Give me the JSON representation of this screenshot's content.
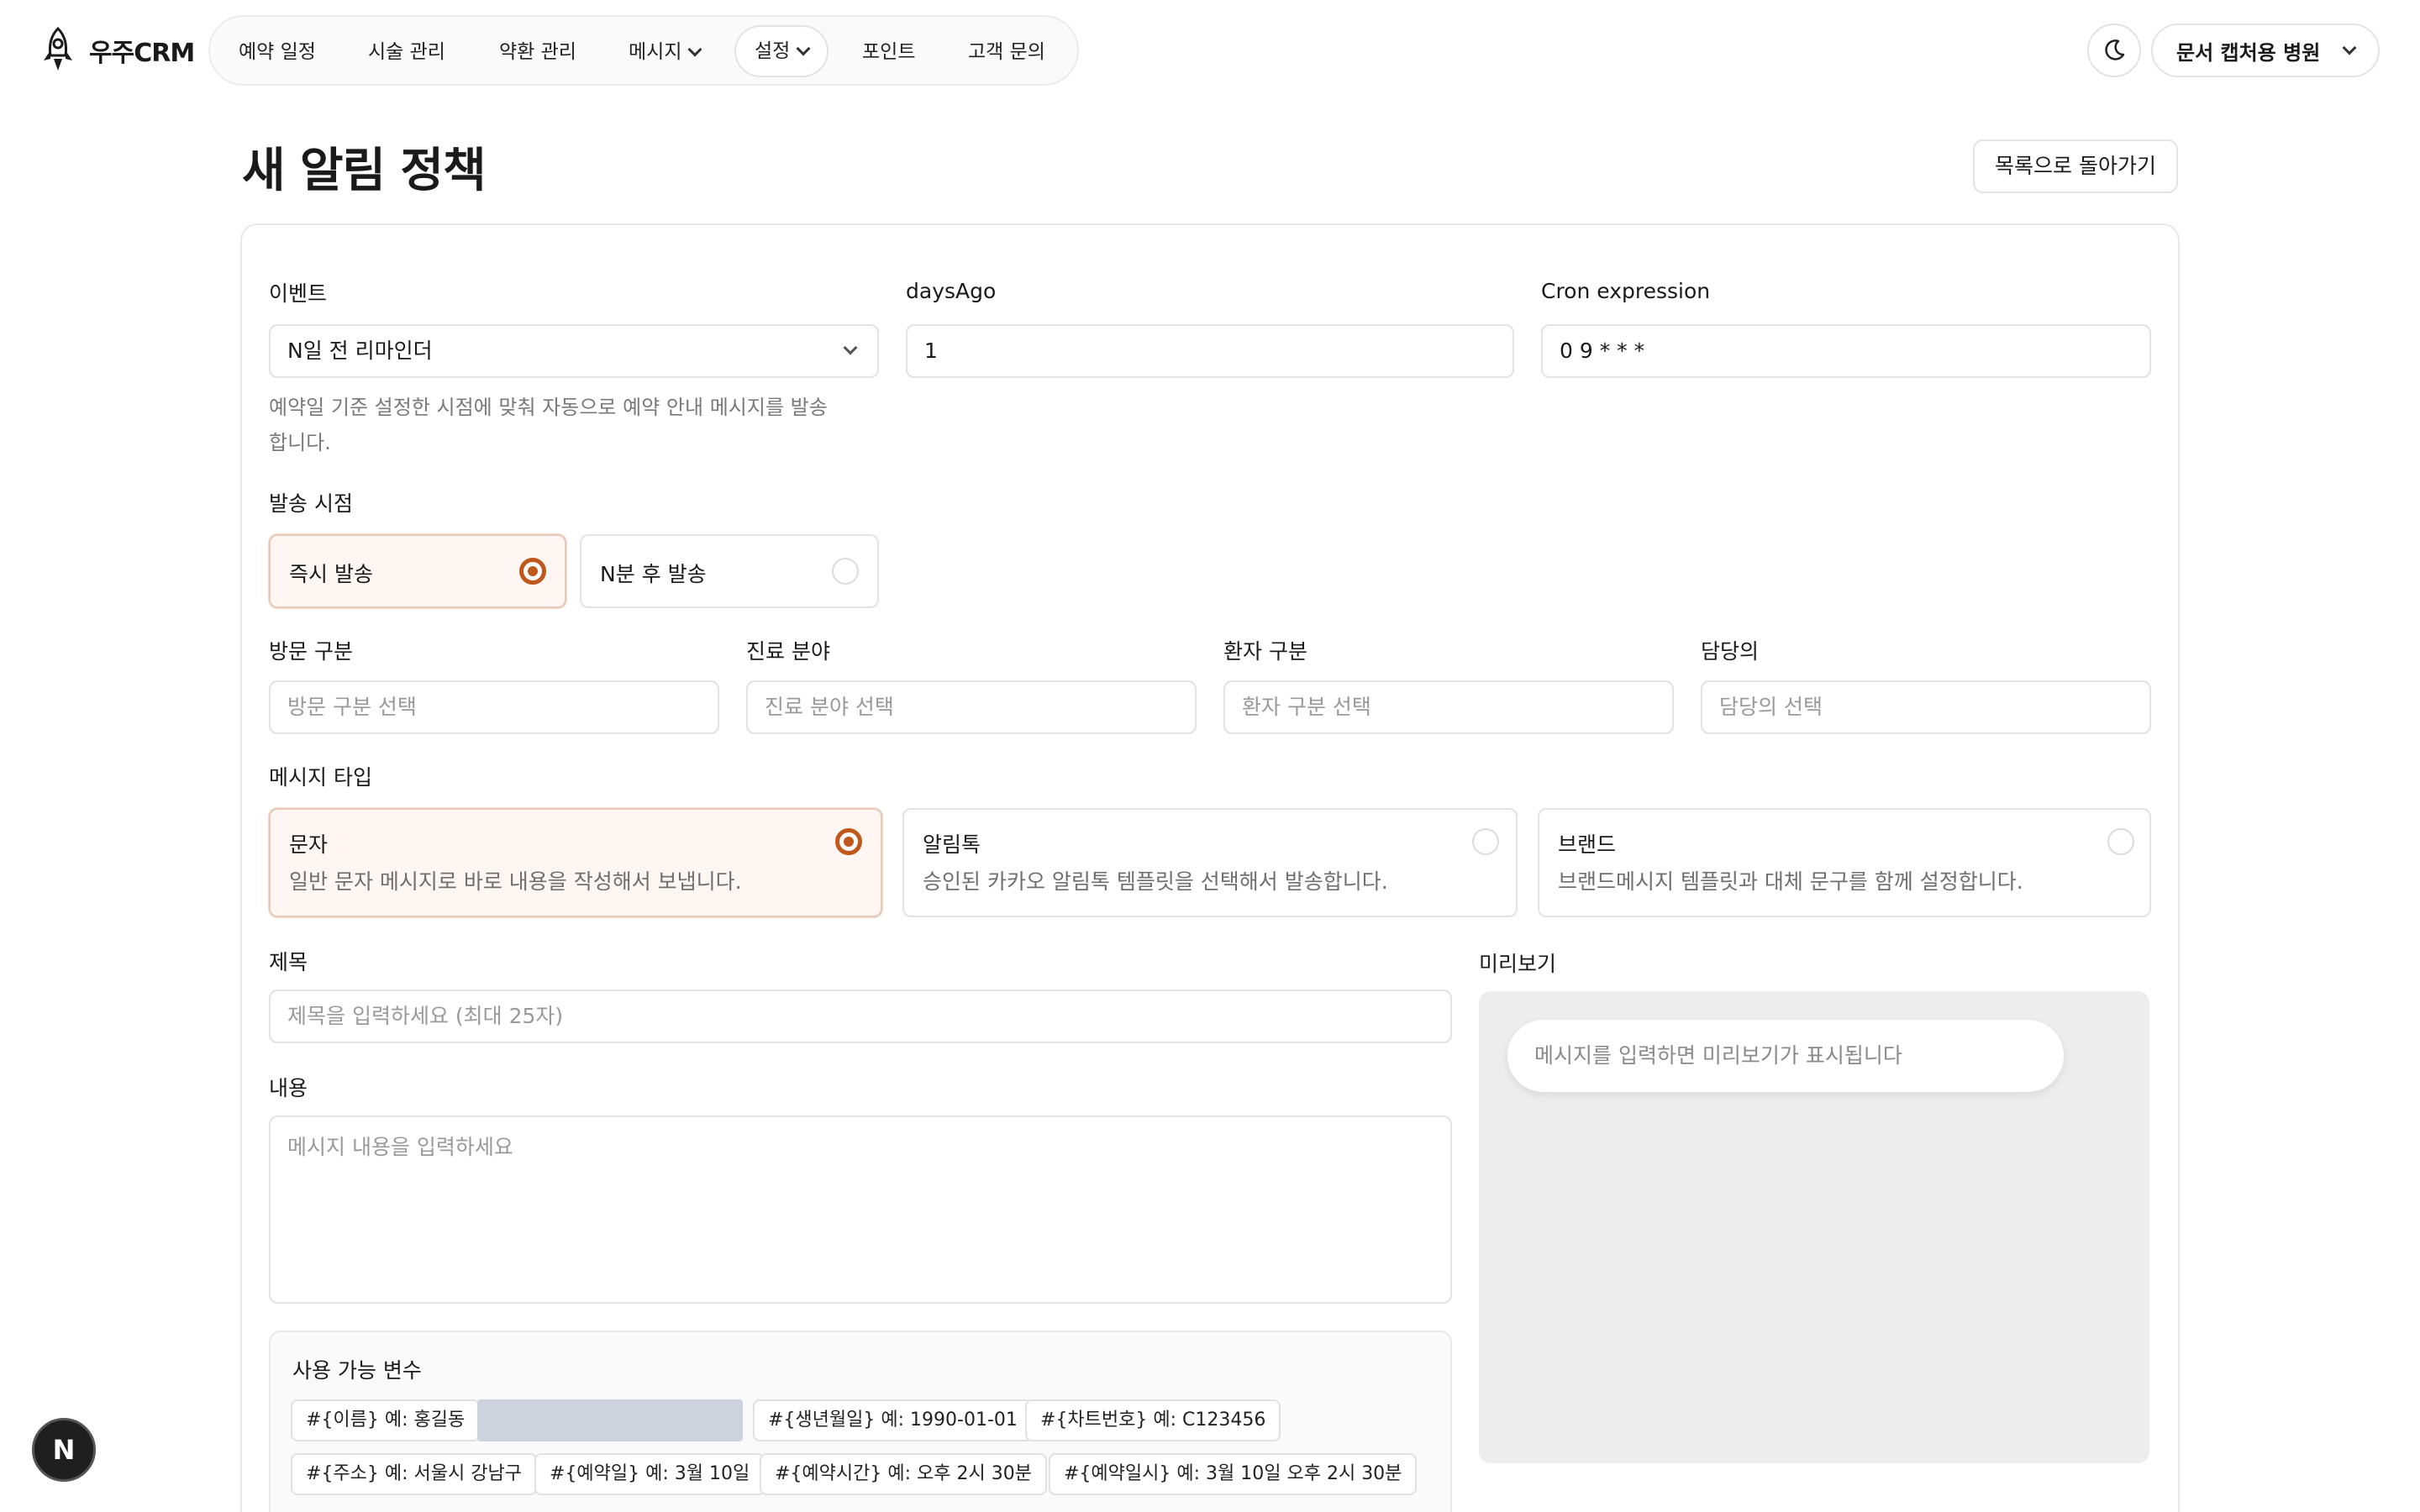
{
  "app": {
    "name": "우주CRM"
  },
  "nav": {
    "items": [
      {
        "label": "예약 일정"
      },
      {
        "label": "시술 관리"
      },
      {
        "label": "약환 관리"
      },
      {
        "label": "메시지"
      },
      {
        "label": "설정"
      },
      {
        "label": "포인트"
      },
      {
        "label": "고객 문의"
      }
    ],
    "active_index": 4,
    "account_label": "문서 캡처용 병원"
  },
  "page": {
    "title": "새 알림 정책",
    "back_label": "목록으로 돌아가기"
  },
  "form": {
    "event": {
      "label": "이벤트",
      "value": "N일 전 리마인더",
      "helper": "예약일 기준 설정한 시점에 맞춰 자동으로 예약 안내 메시지를 발송",
      "helper2": "합니다."
    },
    "days_ago": {
      "label": "daysAgo",
      "value": "1"
    },
    "cron": {
      "label": "Cron expression",
      "value": "0 9 * * *"
    },
    "send_timing": {
      "label": "발송 시점",
      "options": [
        {
          "label": "즉시 발송",
          "selected": true
        },
        {
          "label": "N분 후 발송",
          "selected": false
        }
      ]
    },
    "visit_type": {
      "label": "방문 구분",
      "placeholder": "방문 구분 선택"
    },
    "treatment_area": {
      "label": "진료 분야",
      "placeholder": "진료 분야 선택"
    },
    "patient_type": {
      "label": "환자 구분",
      "placeholder": "환자 구분 선택"
    },
    "doctor": {
      "label": "담당의",
      "placeholder": "담당의 선택"
    },
    "message_type": {
      "label": "메시지 타입",
      "options": [
        {
          "title": "문자",
          "desc": "일반 문자 메시지로 바로 내용을 작성해서 보냅니다.",
          "selected": true
        },
        {
          "title": "알림톡",
          "desc": "승인된 카카오 알림톡 템플릿을 선택해서 발송합니다.",
          "selected": false
        },
        {
          "title": "브랜드",
          "desc": "브랜드메시지 템플릿과 대체 문구를 함께 설정합니다.",
          "selected": false
        }
      ]
    },
    "subject": {
      "label": "제목",
      "placeholder": "제목을 입력하세요 (최대 25자)"
    },
    "content": {
      "label": "내용",
      "placeholder": "메시지 내용을 입력하세요"
    },
    "preview": {
      "label": "미리보기",
      "empty_text": "메시지를 입력하면 미리보기가 표시됩니다"
    },
    "variables": {
      "title": "사용 가능 변수",
      "row1": [
        "#{이름} 예: 홍길동",
        "#{생년월일} 예: 1990-01-01",
        "#{차트번호} 예: C123456"
      ],
      "row2": [
        "#{주소} 예: 서울시 강남구",
        "#{예약일} 예: 3월 10일",
        "#{예약시간} 예: 오후 2시 30분",
        "#{예약일시} 예: 3월 10일 오후 2시 30분"
      ]
    }
  },
  "badge": {
    "label": "N"
  }
}
